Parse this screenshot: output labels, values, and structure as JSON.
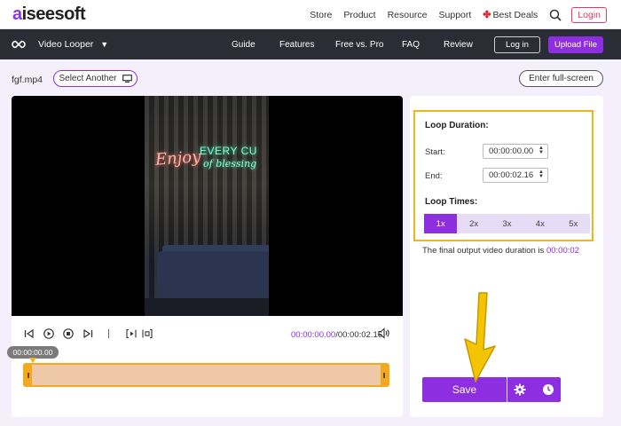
{
  "topbar": {
    "logo_mark": "a",
    "logo_rest": "iseesoft",
    "nav": [
      "Store",
      "Product",
      "Resource",
      "Support"
    ],
    "deal": "Best Deals",
    "login": "Login"
  },
  "darkbar": {
    "tool": "Video Looper",
    "nav": [
      "Guide",
      "Features",
      "Free vs. Pro",
      "FAQ",
      "Review"
    ],
    "login": "Log in",
    "upload": "Upload File"
  },
  "file": {
    "name": "fgf.mp4",
    "select_another": "Select Another",
    "fullscreen": "Enter full-screen"
  },
  "video": {
    "neon_line1": "Enjoy",
    "neon_line2": "EVERY CU",
    "neon_line3": "of blessing"
  },
  "player": {
    "current_time": "00:00:00.00",
    "separator": "/",
    "total_time": "00:00:02.16",
    "timeline_tooltip": "00:00:00.00"
  },
  "settings": {
    "duration_title": "Loop Duration:",
    "start_label": "Start:",
    "start_value": "00:00:00.00",
    "end_label": "End:",
    "end_value": "00:00:02.16",
    "times_title": "Loop Times:",
    "times": [
      "1x",
      "2x",
      "3x",
      "4x",
      "5x"
    ],
    "selected_time": "1x",
    "final_text": "The final output video duration is ",
    "final_duration": "00:00:02"
  },
  "actions": {
    "save": "Save"
  },
  "colors": {
    "accent": "#8d2fe0",
    "highlight": "#f0b324",
    "dark_bar": "#2b2d36"
  }
}
